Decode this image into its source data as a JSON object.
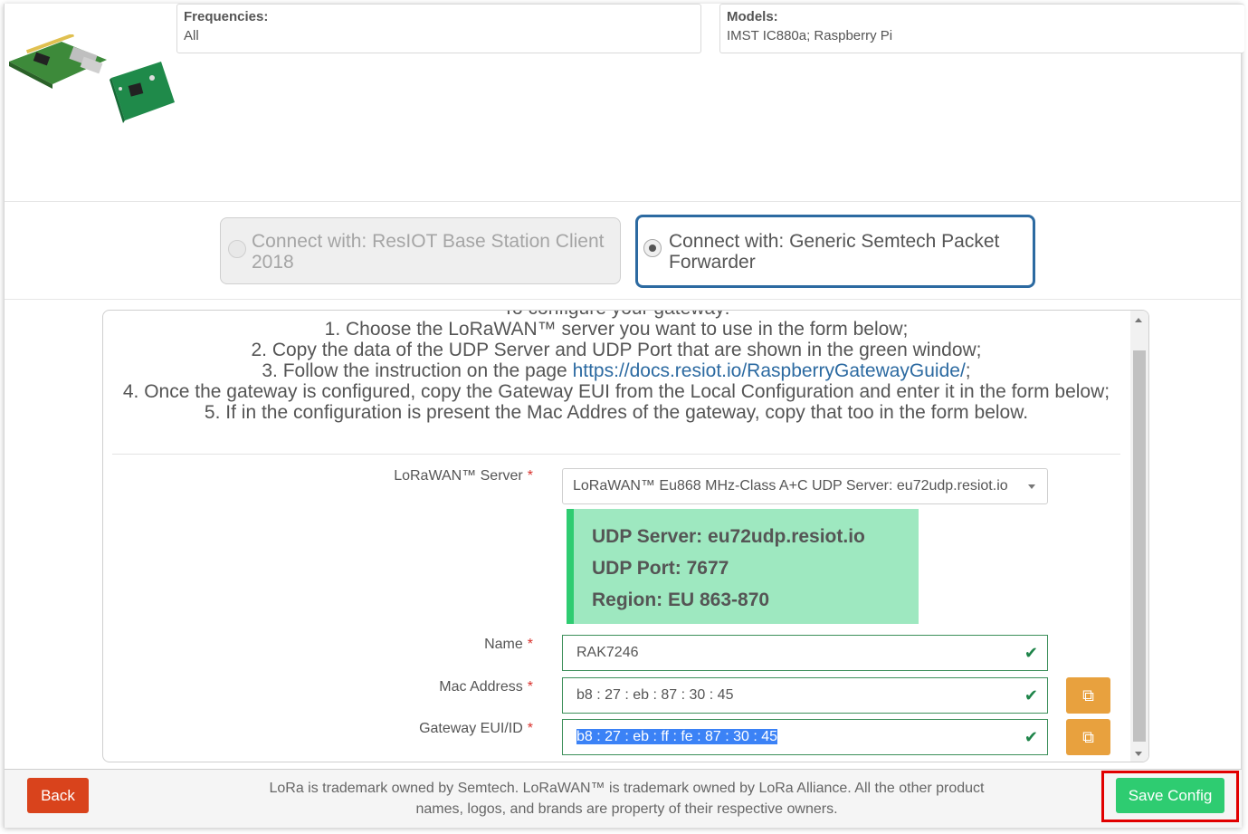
{
  "gateway_info": {
    "frequencies_label": "Frequencies:",
    "frequencies_value": "All",
    "models_label": "Models:",
    "models_value": "IMST IC880a; Raspberry Pi"
  },
  "connection_options": [
    {
      "label": "Connect with: ResIOT Base Station Client 2018",
      "selected": false
    },
    {
      "label": "Connect with: Generic Semtech Packet Forwarder",
      "selected": true
    }
  ],
  "instructions": {
    "heading": "To configure your gateway:",
    "step1": "1. Choose the LoRaWAN™ server you want to use in the form below;",
    "step2": "2. Copy the data of the UDP Server and UDP Port that are shown in the green window;",
    "step3_pre": "3. Follow the instruction on the page ",
    "step3_link": "https://docs.resiot.io/RaspberryGatewayGuide/",
    "step3_post": ";",
    "step4": "4. Once the gateway is configured, copy the Gateway EUI from the Local Configuration and enter it in the form below;",
    "step5": "5. If in the configuration is present the Mac Addres of the gateway, copy that too in the form below."
  },
  "form": {
    "server_label": "LoRaWAN™ Server",
    "server_value": "LoRaWAN™ Eu868 MHz-Class A+C UDP Server: eu72udp.resiot.io",
    "required_mark": "*",
    "udp_server": "UDP Server: eu72udp.resiot.io",
    "udp_port": "UDP Port: 7677",
    "region": "Region: EU 863-870",
    "name_label": "Name",
    "name_value": "RAK7246",
    "mac_label": "Mac Address",
    "mac_value": "b8 : 27 : eb : 87 : 30 : 45",
    "eui_label": "Gateway EUI/ID",
    "eui_value": "b8 : 27 : eb : ff : fe : 87 : 30 : 45"
  },
  "footer": {
    "back_label": "Back",
    "trademark_text": "LoRa is trademark owned by Semtech. LoRaWAN™ is trademark owned by LoRa Alliance. All the other product names, logos, and brands are property of their respective owners.",
    "save_label": "Save Config"
  },
  "colors": {
    "accent_blue": "#2c6aa1",
    "udp_box_bg": "#9ee8c0",
    "udp_box_border": "#2ecc71",
    "back_button": "#d9431c",
    "save_button": "#2ecc71",
    "copy_button": "#e8a13e",
    "highlight_outline": "#e10000"
  }
}
